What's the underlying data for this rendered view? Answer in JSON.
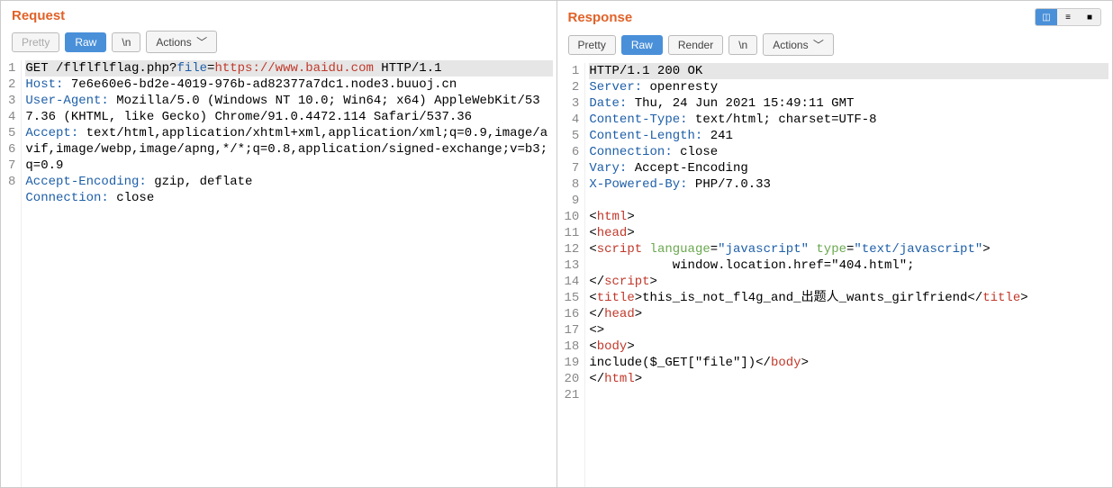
{
  "request": {
    "title": "Request",
    "toolbar": {
      "pretty": "Pretty",
      "raw": "Raw",
      "newline": "\\n",
      "actions": "Actions"
    },
    "lines": [
      {
        "n": "1",
        "hl": true,
        "segs": [
          {
            "t": "GET /flflflflag.php?",
            "c": ""
          },
          {
            "t": "file",
            "c": "k-param"
          },
          {
            "t": "=",
            "c": ""
          },
          {
            "t": "https://www.baidu.com",
            "c": "k-red"
          },
          {
            "t": " HTTP/1.1",
            "c": ""
          }
        ]
      },
      {
        "n": "2",
        "segs": [
          {
            "t": "Host:",
            "c": "k-header"
          },
          {
            "t": " 7e6e60e6-bd2e-4019-976b-ad82377a7dc1.node3.buuoj.cn",
            "c": ""
          }
        ]
      },
      {
        "n": "3",
        "segs": [
          {
            "t": "User-Agent:",
            "c": "k-header"
          },
          {
            "t": " Mozilla/5.0 (Windows NT 10.0; Win64; x64) AppleWebKit/537.36 (KHTML, like Gecko) Chrome/91.0.4472.114 Safari/537.36",
            "c": ""
          }
        ]
      },
      {
        "n": "4",
        "segs": [
          {
            "t": "Accept:",
            "c": "k-header"
          },
          {
            "t": " text/html,application/xhtml+xml,application/xml;q=0.9,image/avif,image/webp,image/apng,*/*;q=0.8,application/signed-exchange;v=b3;q=0.9",
            "c": ""
          }
        ]
      },
      {
        "n": "5",
        "segs": [
          {
            "t": "Accept-Encoding:",
            "c": "k-header"
          },
          {
            "t": " gzip, deflate",
            "c": ""
          }
        ]
      },
      {
        "n": "6",
        "segs": [
          {
            "t": "Connection:",
            "c": "k-header"
          },
          {
            "t": " close",
            "c": ""
          }
        ]
      },
      {
        "n": "7",
        "segs": [
          {
            "t": "",
            "c": ""
          }
        ]
      },
      {
        "n": "8",
        "segs": [
          {
            "t": "",
            "c": ""
          }
        ]
      }
    ]
  },
  "response": {
    "title": "Response",
    "toolbar": {
      "pretty": "Pretty",
      "raw": "Raw",
      "render": "Render",
      "newline": "\\n",
      "actions": "Actions"
    },
    "lines": [
      {
        "n": "1",
        "hl": true,
        "segs": [
          {
            "t": "HTTP/1.1 200 OK",
            "c": ""
          }
        ]
      },
      {
        "n": "2",
        "segs": [
          {
            "t": "Server:",
            "c": "k-header"
          },
          {
            "t": " openresty",
            "c": ""
          }
        ]
      },
      {
        "n": "3",
        "segs": [
          {
            "t": "Date:",
            "c": "k-header"
          },
          {
            "t": " Thu, 24 Jun 2021 15:49:11 GMT",
            "c": ""
          }
        ]
      },
      {
        "n": "4",
        "segs": [
          {
            "t": "Content-Type:",
            "c": "k-header"
          },
          {
            "t": " text/html; charset=UTF-8",
            "c": ""
          }
        ]
      },
      {
        "n": "5",
        "segs": [
          {
            "t": "Content-Length:",
            "c": "k-header"
          },
          {
            "t": " 241",
            "c": ""
          }
        ]
      },
      {
        "n": "6",
        "segs": [
          {
            "t": "Connection:",
            "c": "k-header"
          },
          {
            "t": " close",
            "c": ""
          }
        ]
      },
      {
        "n": "7",
        "segs": [
          {
            "t": "Vary:",
            "c": "k-header"
          },
          {
            "t": " Accept-Encoding",
            "c": ""
          }
        ]
      },
      {
        "n": "8",
        "segs": [
          {
            "t": "X-Powered-By:",
            "c": "k-header"
          },
          {
            "t": " PHP/7.0.33",
            "c": ""
          }
        ]
      },
      {
        "n": "9",
        "segs": [
          {
            "t": "",
            "c": ""
          }
        ]
      },
      {
        "n": "10",
        "segs": [
          {
            "t": "<",
            "c": ""
          },
          {
            "t": "html",
            "c": "k-tag"
          },
          {
            "t": ">",
            "c": ""
          }
        ]
      },
      {
        "n": "11",
        "segs": [
          {
            "t": "<",
            "c": ""
          },
          {
            "t": "head",
            "c": "k-tag"
          },
          {
            "t": ">",
            "c": ""
          }
        ]
      },
      {
        "n": "12",
        "segs": [
          {
            "t": "<",
            "c": ""
          },
          {
            "t": "script",
            "c": "k-tag"
          },
          {
            "t": " ",
            "c": ""
          },
          {
            "t": "language",
            "c": "k-attr"
          },
          {
            "t": "=",
            "c": ""
          },
          {
            "t": "\"",
            "c": "k-val"
          },
          {
            "t": "javascript",
            "c": "k-val"
          },
          {
            "t": "\"",
            "c": "k-val"
          },
          {
            "t": " ",
            "c": ""
          },
          {
            "t": "type",
            "c": "k-attr"
          },
          {
            "t": "=",
            "c": ""
          },
          {
            "t": "\"",
            "c": "k-val"
          },
          {
            "t": "text/javascript",
            "c": "k-val"
          },
          {
            "t": "\"",
            "c": "k-val"
          },
          {
            "t": ">",
            "c": ""
          }
        ]
      },
      {
        "n": "13",
        "segs": [
          {
            "t": "           window.location.href=\"404.html\";",
            "c": ""
          }
        ]
      },
      {
        "n": "14",
        "segs": [
          {
            "t": "</",
            "c": ""
          },
          {
            "t": "script",
            "c": "k-tag"
          },
          {
            "t": ">",
            "c": ""
          }
        ]
      },
      {
        "n": "15",
        "segs": [
          {
            "t": "<",
            "c": ""
          },
          {
            "t": "title",
            "c": "k-tag"
          },
          {
            "t": ">",
            "c": ""
          },
          {
            "t": "this_is_not_fl4g_and_出题人_wants_girlfriend",
            "c": ""
          },
          {
            "t": "</",
            "c": ""
          },
          {
            "t": "title",
            "c": "k-tag"
          },
          {
            "t": ">",
            "c": ""
          }
        ]
      },
      {
        "n": "16",
        "segs": [
          {
            "t": "</",
            "c": ""
          },
          {
            "t": "head",
            "c": "k-tag"
          },
          {
            "t": ">",
            "c": ""
          }
        ]
      },
      {
        "n": "17",
        "segs": [
          {
            "t": "<>",
            "c": ""
          }
        ]
      },
      {
        "n": "18",
        "segs": [
          {
            "t": "<",
            "c": ""
          },
          {
            "t": "body",
            "c": "k-tag"
          },
          {
            "t": ">",
            "c": ""
          }
        ]
      },
      {
        "n": "19",
        "segs": [
          {
            "t": "include($_GET[\"file\"])",
            "c": ""
          },
          {
            "t": "</",
            "c": ""
          },
          {
            "t": "body",
            "c": "k-tag"
          },
          {
            "t": ">",
            "c": ""
          }
        ]
      },
      {
        "n": "20",
        "segs": [
          {
            "t": "</",
            "c": ""
          },
          {
            "t": "html",
            "c": "k-tag"
          },
          {
            "t": ">",
            "c": ""
          }
        ]
      },
      {
        "n": "21",
        "segs": [
          {
            "t": "",
            "c": ""
          }
        ]
      }
    ]
  }
}
